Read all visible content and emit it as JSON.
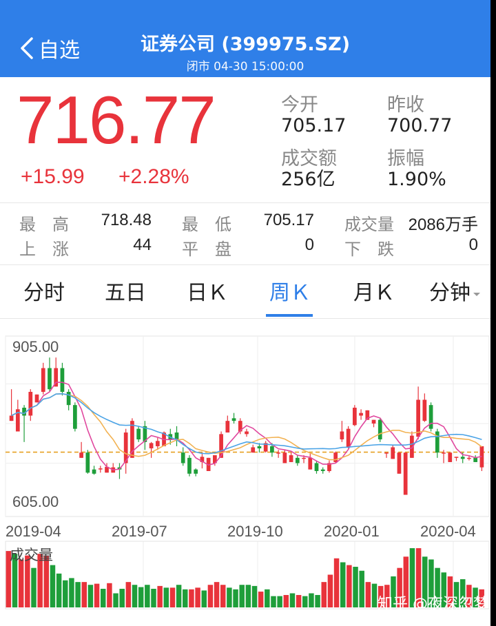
{
  "header": {
    "back_label": "自选",
    "title": "证券公司 (399975.SZ)",
    "subtitle": "闭市 04-30 15:00:00"
  },
  "quote": {
    "price": "716.77",
    "change": "+15.99",
    "change_pct": "+2.28%",
    "open_label": "今开",
    "open": "705.17",
    "prev_close_label": "昨收",
    "prev_close": "700.77",
    "turnover_label": "成交额",
    "turnover": "256亿",
    "amplitude_label": "振幅",
    "amplitude": "1.90%"
  },
  "stats": {
    "high_label": "最　高",
    "high": "718.48",
    "low_label": "最　低",
    "low": "705.17",
    "volume_label": "成交量",
    "volume": "2086万手",
    "up_label": "上　涨",
    "up": "44",
    "flat_label": "平　盘",
    "flat": "0",
    "down_label": "下　跌",
    "down": "0"
  },
  "tabs": [
    {
      "label": "分时"
    },
    {
      "label": "五日"
    },
    {
      "label": "日Ｋ"
    },
    {
      "label": "周Ｋ"
    },
    {
      "label": "月Ｋ"
    },
    {
      "label": "分钟"
    }
  ],
  "active_tab": 3,
  "colors": {
    "accent": "#2f7fe8",
    "up": "#e8333b",
    "down": "#1e9e3a",
    "ma5": "#e0479e",
    "ma10": "#f2b252",
    "ma20": "#4aa3e6",
    "ref_line": "#e6a020"
  },
  "chart_data": {
    "type": "candlestick",
    "y_top_label": "905.00",
    "y_bottom_label": "605.00",
    "ylim": [
      605,
      905
    ],
    "reference_price": 700.77,
    "x_tick_labels": [
      "2019-04",
      "2019-07",
      "2019-10",
      "2020-01",
      "2020-04"
    ],
    "volume_label": "成交量",
    "candles": [
      [
        760,
        770,
        790,
        820
      ],
      [
        740,
        782,
        745,
        800
      ],
      [
        785,
        770,
        790,
        720
      ],
      [
        770,
        815,
        760,
        820
      ],
      [
        795,
        810,
        795,
        810
      ],
      [
        815,
        860,
        810,
        870
      ],
      [
        860,
        820,
        880,
        815
      ],
      [
        825,
        860,
        830,
        880
      ],
      [
        860,
        815,
        870,
        808
      ],
      [
        815,
        790,
        820,
        780
      ],
      [
        790,
        745,
        795,
        740
      ],
      [
        690,
        700,
        690,
        720
      ],
      [
        700,
        662,
        705,
        660
      ],
      [
        668,
        660,
        675,
        658
      ],
      [
        670,
        670,
        675,
        662
      ],
      [
        662,
        673,
        668,
        680
      ],
      [
        662,
        672,
        665,
        680
      ],
      [
        672,
        668,
        680,
        650
      ],
      [
        680,
        738,
        660,
        745
      ],
      [
        690,
        760,
        690,
        765
      ],
      [
        745,
        725,
        750,
        720
      ],
      [
        750,
        720,
        760,
        705
      ],
      [
        708,
        718,
        720,
        690
      ],
      [
        712,
        722,
        728,
        705
      ],
      [
        712,
        738,
        715,
        740
      ],
      [
        735,
        725,
        745,
        715
      ],
      [
        738,
        725,
        750,
        712
      ],
      [
        700,
        680,
        710,
        675
      ],
      [
        690,
        660,
        695,
        655
      ],
      [
        668,
        660,
        670,
        655
      ],
      [
        682,
        692,
        700,
        670
      ],
      [
        665,
        690,
        680,
        672
      ],
      [
        680,
        695,
        690,
        675
      ],
      [
        690,
        735,
        690,
        740
      ],
      [
        738,
        760,
        738,
        770
      ],
      [
        765,
        760,
        775,
        755
      ],
      [
        740,
        760,
        735,
        765
      ],
      [
        735,
        740,
        745,
        730
      ],
      [
        700,
        710,
        705,
        715
      ],
      [
        712,
        708,
        718,
        700
      ],
      [
        702,
        718,
        700,
        722
      ],
      [
        712,
        700,
        718,
        692
      ],
      [
        700,
        700,
        705,
        690
      ],
      [
        680,
        700,
        680,
        705
      ],
      [
        682,
        695,
        685,
        700
      ],
      [
        690,
        680,
        695,
        675
      ],
      [
        690,
        690,
        695,
        680
      ],
      [
        668,
        690,
        668,
        698
      ],
      [
        680,
        665,
        685,
        660
      ],
      [
        668,
        665,
        672,
        660
      ],
      [
        665,
        680,
        662,
        685
      ],
      [
        682,
        700,
        680,
        702
      ],
      [
        725,
        740,
        720,
        760
      ],
      [
        710,
        745,
        708,
        750
      ],
      [
        752,
        785,
        750,
        790
      ],
      [
        770,
        775,
        782,
        762
      ],
      [
        762,
        780,
        765,
        775
      ],
      [
        755,
        762,
        758,
        748
      ],
      [
        762,
        725,
        765,
        720
      ],
      [
        700,
        700,
        700,
        690
      ],
      [
        688,
        710,
        688,
        715
      ],
      [
        660,
        700,
        660,
        690
      ],
      [
        620,
        700,
        620,
        680
      ],
      [
        690,
        732,
        690,
        740
      ],
      [
        730,
        800,
        725,
        825
      ],
      [
        760,
        800,
        758,
        812
      ],
      [
        790,
        745,
        795,
        740
      ],
      [
        740,
        700,
        745,
        690
      ],
      [
        700,
        700,
        705,
        680
      ],
      [
        682,
        700,
        682,
        700
      ],
      [
        690,
        692,
        692,
        684
      ],
      [
        692,
        688,
        700,
        680
      ],
      [
        688,
        690,
        695,
        685
      ],
      [
        690,
        682,
        690,
        695
      ],
      [
        672,
        712,
        665,
        712
      ]
    ],
    "volume": [
      [
        100,
        1
      ],
      [
        95,
        0
      ],
      [
        85,
        1
      ],
      [
        92,
        1
      ],
      [
        70,
        0
      ],
      [
        95,
        1
      ],
      [
        92,
        1
      ],
      [
        75,
        0
      ],
      [
        60,
        0
      ],
      [
        48,
        0
      ],
      [
        52,
        0
      ],
      [
        45,
        0
      ],
      [
        45,
        1
      ],
      [
        40,
        0
      ],
      [
        42,
        1
      ],
      [
        33,
        0
      ],
      [
        43,
        1
      ],
      [
        25,
        0
      ],
      [
        33,
        0
      ],
      [
        45,
        1
      ],
      [
        40,
        0
      ],
      [
        36,
        0
      ],
      [
        40,
        0
      ],
      [
        33,
        0
      ],
      [
        38,
        1
      ],
      [
        35,
        0
      ],
      [
        35,
        1
      ],
      [
        40,
        0
      ],
      [
        32,
        0
      ],
      [
        32,
        1
      ],
      [
        35,
        1
      ],
      [
        30,
        0
      ],
      [
        40,
        1
      ],
      [
        45,
        1
      ],
      [
        40,
        1
      ],
      [
        35,
        0
      ],
      [
        32,
        0
      ],
      [
        40,
        0
      ],
      [
        40,
        0
      ],
      [
        38,
        0
      ],
      [
        28,
        1
      ],
      [
        32,
        0
      ],
      [
        20,
        0
      ],
      [
        20,
        0
      ],
      [
        22,
        1
      ],
      [
        25,
        0
      ],
      [
        22,
        1
      ],
      [
        20,
        0
      ],
      [
        25,
        0
      ],
      [
        22,
        0
      ],
      [
        45,
        1
      ],
      [
        58,
        1
      ],
      [
        87,
        1
      ],
      [
        80,
        0
      ],
      [
        75,
        1
      ],
      [
        72,
        0
      ],
      [
        65,
        0
      ],
      [
        45,
        1
      ],
      [
        42,
        0
      ],
      [
        38,
        1
      ],
      [
        40,
        1
      ],
      [
        55,
        0
      ],
      [
        70,
        1
      ],
      [
        90,
        1
      ],
      [
        105,
        0
      ],
      [
        105,
        1
      ],
      [
        90,
        0
      ],
      [
        85,
        0
      ],
      [
        70,
        0
      ],
      [
        62,
        0
      ],
      [
        55,
        1
      ],
      [
        45,
        0
      ],
      [
        50,
        0
      ],
      [
        40,
        1
      ],
      [
        35,
        0
      ],
      [
        32,
        1
      ]
    ]
  },
  "watermark": "知乎 @夜深忽梦"
}
